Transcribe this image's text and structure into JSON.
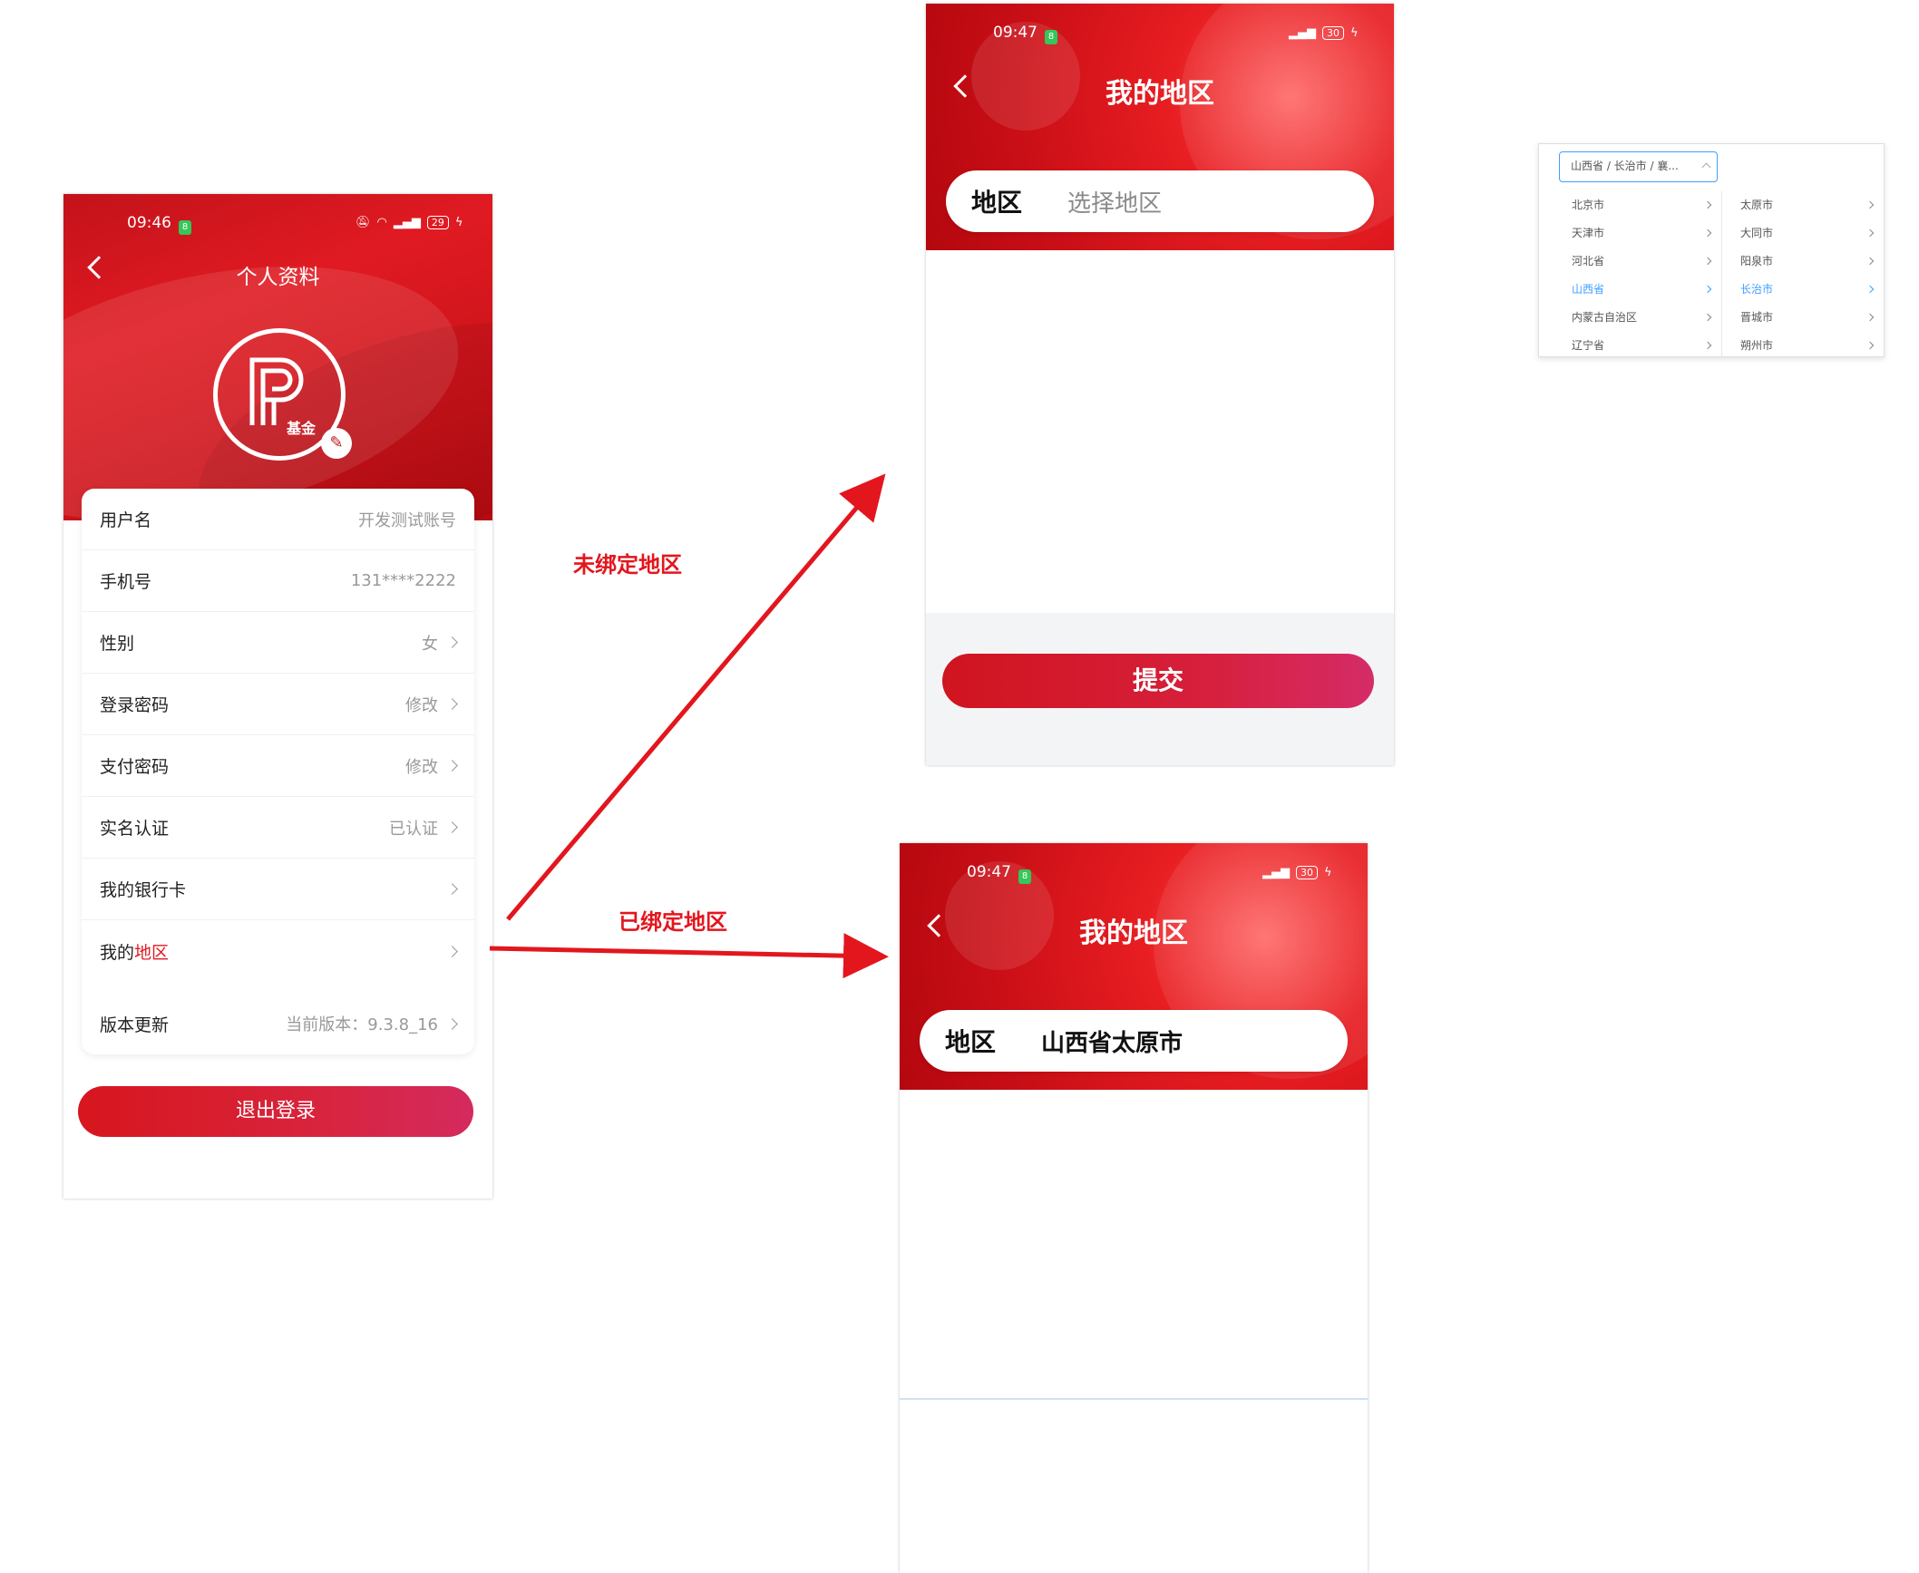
{
  "profile_screen": {
    "status_time": "09:46",
    "battery": "29",
    "title": "个人资料",
    "logo_sub": "基金",
    "rows": [
      {
        "label": "用户名",
        "value": "开发测试账号"
      },
      {
        "label": "手机号",
        "value": "131****2222"
      },
      {
        "label": "性别",
        "value": "女"
      },
      {
        "label": "登录密码",
        "value": "修改"
      },
      {
        "label": "支付密码",
        "value": "修改"
      },
      {
        "label": "实名认证",
        "value": "已认证"
      },
      {
        "label": "我的银行卡",
        "value": ""
      },
      {
        "label": "我的",
        "label_highlight": "地区",
        "value": ""
      },
      {
        "label": "版本更新",
        "value": "当前版本：9.3.8_16"
      }
    ],
    "logout": "退出登录"
  },
  "annotations": {
    "unbound": "未绑定地区",
    "bound": "已绑定地区"
  },
  "region_unbound_screen": {
    "status_time": "09:47",
    "battery": "30",
    "title": "我的地区",
    "field_label": "地区",
    "placeholder": "选择地区",
    "submit": "提交"
  },
  "region_bound_screen": {
    "status_time": "09:47",
    "battery": "30",
    "title": "我的地区",
    "field_label": "地区",
    "value": "山西省太原市"
  },
  "cascader": {
    "input_value": "山西省 / 长治市 / 襄...",
    "provinces": [
      "北京市",
      "天津市",
      "河北省",
      "山西省",
      "内蒙古自治区",
      "辽宁省"
    ],
    "cities": [
      "太原市",
      "大同市",
      "阳泉市",
      "长治市",
      "晋城市",
      "朔州市"
    ],
    "active_province": "山西省",
    "active_city": "长治市"
  },
  "colors": {
    "brand_red": "#e01a22",
    "active_blue": "#409eff"
  }
}
